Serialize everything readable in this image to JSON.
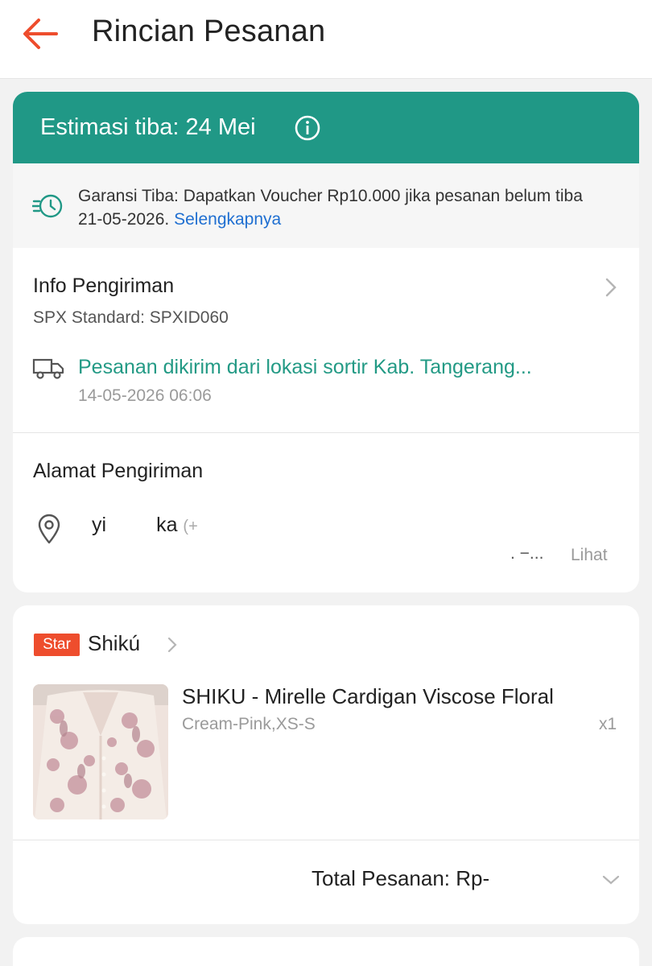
{
  "header": {
    "title": "Rincian Pesanan"
  },
  "eta": {
    "text": "Estimasi tiba: 24 Mei"
  },
  "guarantee": {
    "text": "Garansi Tiba: Dapatkan Voucher Rp10.000 jika pesanan belum tiba 21-05-2026.",
    "link": "Selengkapnya"
  },
  "shipping": {
    "title": "Info Pengiriman",
    "service": "SPX Standard: SPXID060",
    "status": "Pesanan dikirim dari lokasi sortir Kab. Tangerang...",
    "time": "14-05-2026 06:06"
  },
  "address": {
    "title": "Alamat Pengiriman",
    "name_start": "yi",
    "name_end": "ka",
    "phone": "(+",
    "more": ". −...",
    "view": "Lihat"
  },
  "shop": {
    "badge": "Star",
    "name": "Shikú"
  },
  "product": {
    "name": "SHIKU - Mirelle Cardigan Viscose Floral",
    "variant": "Cream-Pink,XS-S",
    "quantity": "x1"
  },
  "order": {
    "total_label": "Total Pesanan:",
    "total_value": "Rp-"
  },
  "colors": {
    "accent": "#ee4d2d",
    "eta_bar": "#209886",
    "status_text": "#239a85",
    "link": "#1f6fd1"
  }
}
